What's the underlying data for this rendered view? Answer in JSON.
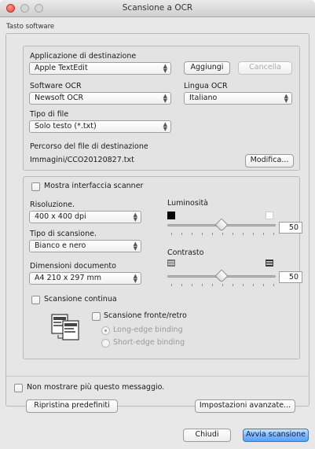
{
  "window": {
    "title": "Scansione a OCR"
  },
  "software_tab": {
    "label": "Tasto software"
  },
  "destination": {
    "app_label": "Applicazione di destinazione",
    "app_value": "Apple TextEdit",
    "add_button": "Aggiungi",
    "delete_button": "Cancella",
    "ocr_software_label": "Software OCR",
    "ocr_software_value": "Newsoft OCR",
    "ocr_language_label": "Lingua OCR",
    "ocr_language_value": "Italiano",
    "file_type_label": "Tipo di file",
    "file_type_value": "Solo testo (*.txt)",
    "path_label": "Percorso del file di destinazione",
    "path_value": "Immagini/CCO20120827.txt",
    "modify_button": "Modifica..."
  },
  "scan": {
    "show_interface_label": "Mostra interfaccia scanner",
    "show_interface_checked": false,
    "resolution_label": "Risoluzione.",
    "resolution_value": "400 x 400 dpi",
    "scan_type_label": "Tipo di scansione.",
    "scan_type_value": "Bianco e nero",
    "document_size_label": "Dimensioni documento",
    "document_size_value": "A4 210 x 297 mm",
    "brightness_label": "Luminosità",
    "brightness_value": "50",
    "contrast_label": "Contrasto",
    "contrast_value": "50",
    "continuous_label": "Scansione continua",
    "continuous_checked": false,
    "duplex_label": "Scansione fronte/retro",
    "duplex_checked": false,
    "long_edge_label": "Long-edge binding",
    "short_edge_label": "Short-edge binding",
    "long_edge_selected": true
  },
  "footer": {
    "dont_show_label": "Non mostrare più questo messaggio.",
    "dont_show_checked": false,
    "restore_defaults_button": "Ripristina predefiniti",
    "advanced_button": "Impostazioni avanzate...",
    "close_button": "Chiudi",
    "start_button": "Avvia scansione"
  }
}
